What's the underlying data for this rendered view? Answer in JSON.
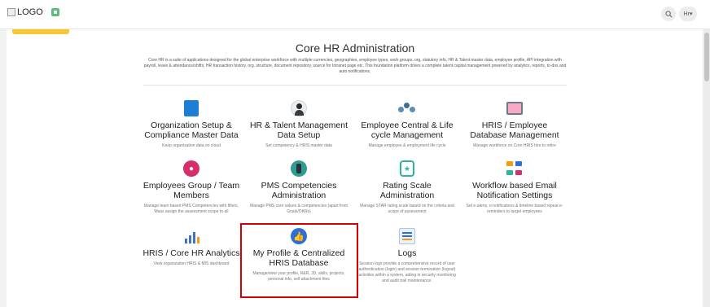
{
  "header": {
    "logo_text": "LOGO",
    "user_label": "Hr",
    "search_icon": "search-icon",
    "home_icon": "home-icon"
  },
  "page": {
    "title": "Core HR Administration",
    "description": "Core HR is a suite of applications designed for the global enterprise workforce with multiple currencies, geographies, employee types, work groups, org, statutory info, HR & Talent master data, employee profile, API integration with payroll, leave & attendance/shifts, HR transaction history, org. structure, document repository, source for Intranet page etc. This foundation platform drives a complete talent capital management powered by analytics, reports, to-dos and auto notifications."
  },
  "tiles": [
    {
      "name": "Organization Setup & Compliance Master Data",
      "sub": "Keep organization data on cloud",
      "icon": "building-icon"
    },
    {
      "name": "HR & Talent Management Data Setup",
      "sub": "Set competency & HRIS master data",
      "icon": "person-icon"
    },
    {
      "name": "Employee Central & Life cycle Management",
      "sub": "Manage employee & employment life cycle",
      "icon": "group-icon"
    },
    {
      "name": "HRIS / Employee Database Management",
      "sub": "Manage workforce on Core HRIS hire to retire",
      "icon": "monitor-icon"
    },
    {
      "name": "Employees Group / Team Members",
      "sub": "Manage team based PMS Competencies with filters. Mass assign the assessment scope to all",
      "icon": "team-icon"
    },
    {
      "name": "PMS Competencies Administration",
      "sub": "Manage PMS core values & competencies (apart from Goals/OKRs)",
      "icon": "competency-icon"
    },
    {
      "name": "Rating Scale Administration",
      "sub": "Manage STAR rating scale based on the criteria and scope of assessment",
      "icon": "rating-icon"
    },
    {
      "name": "Workflow based Email Notification Settings",
      "sub": "Set e-alerts, e-notifications & timeline based repeat e-reminders to target employees",
      "icon": "workflow-icon"
    },
    {
      "name": "HRIS / Core HR Analytics",
      "sub": "View organization HRIS & MIS dashboard",
      "icon": "analytics-icon"
    },
    {
      "name": "My Profile & Centralized HRIS Database",
      "sub": "Manage/view your profile, R&R, JD, skills, projects, personal info, self attachment files",
      "icon": "thumbs-up-icon"
    },
    {
      "name": "Logs",
      "sub": "Session logs provide a comprehensive record of user authentication (login) and session termination (logout) activities within a system, aiding in security monitoring and audit trail maintenance.",
      "icon": "logs-icon"
    }
  ],
  "colors": {
    "highlight": "#d60000",
    "accent_yellow": "#f5c730"
  }
}
